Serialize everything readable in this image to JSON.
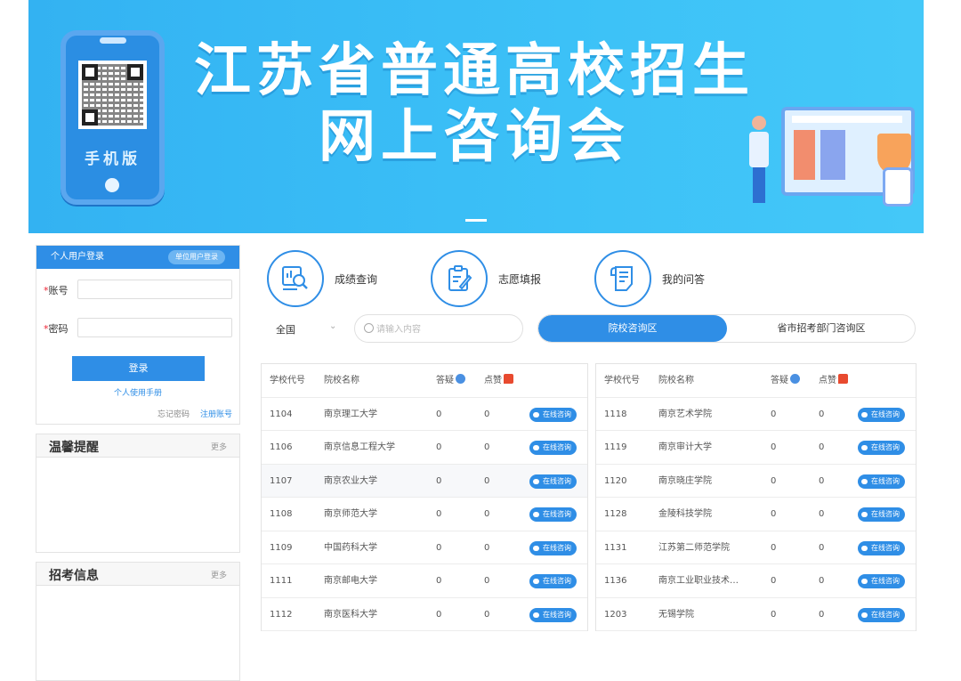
{
  "banner": {
    "title_line1": "江苏省普通高校招生",
    "title_line2": "网上咨询会",
    "phone_label": "手机版"
  },
  "login": {
    "personal_tab": "个人用户登录",
    "unit_tab": "单位用户登录",
    "account_label": "账号",
    "password_label": "密码",
    "login_button": "登录",
    "manual_link": "个人使用手册",
    "forgot_link": "忘记密码",
    "register_link": "注册账号"
  },
  "panels": [
    {
      "title": "温馨提醒",
      "more": "更多"
    },
    {
      "title": "招考信息",
      "more": "更多"
    }
  ],
  "quick_links": [
    {
      "label": "成绩查询",
      "icon": "score-search-icon"
    },
    {
      "label": "志愿填报",
      "icon": "clipboard-edit-icon"
    },
    {
      "label": "我的问答",
      "icon": "qa-document-icon"
    }
  ],
  "filter": {
    "scope": "全国",
    "search_placeholder": "请输入内容",
    "tab_active": "院校咨询区",
    "tab_inactive": "省市招考部门咨询区"
  },
  "table_headers": {
    "code": "学校代号",
    "name": "院校名称",
    "questions": "答疑",
    "likes": "点赞"
  },
  "consult_label": "在线咨询",
  "table_left": [
    {
      "code": "1104",
      "name": "南京理工大学",
      "q": "0",
      "likes": "0"
    },
    {
      "code": "1106",
      "name": "南京信息工程大学",
      "q": "0",
      "likes": "0"
    },
    {
      "code": "1107",
      "name": "南京农业大学",
      "q": "0",
      "likes": "0"
    },
    {
      "code": "1108",
      "name": "南京师范大学",
      "q": "0",
      "likes": "0"
    },
    {
      "code": "1109",
      "name": "中国药科大学",
      "q": "0",
      "likes": "0"
    },
    {
      "code": "1111",
      "name": "南京邮电大学",
      "q": "0",
      "likes": "0"
    },
    {
      "code": "1112",
      "name": "南京医科大学",
      "q": "0",
      "likes": "0"
    }
  ],
  "table_right": [
    {
      "code": "1118",
      "name": "南京艺术学院",
      "q": "0",
      "likes": "0"
    },
    {
      "code": "1119",
      "name": "南京审计大学",
      "q": "0",
      "likes": "0"
    },
    {
      "code": "1120",
      "name": "南京晓庄学院",
      "q": "0",
      "likes": "0"
    },
    {
      "code": "1128",
      "name": "金陵科技学院",
      "q": "0",
      "likes": "0"
    },
    {
      "code": "1131",
      "name": "江苏第二师范学院",
      "q": "0",
      "likes": "0"
    },
    {
      "code": "1136",
      "name": "南京工业职业技术…",
      "q": "0",
      "likes": "0"
    },
    {
      "code": "1203",
      "name": "无锡学院",
      "q": "0",
      "likes": "0"
    }
  ],
  "colors": {
    "primary": "#2f8ee6",
    "banner": "#3cc1f7",
    "like": "#e84a2f"
  }
}
